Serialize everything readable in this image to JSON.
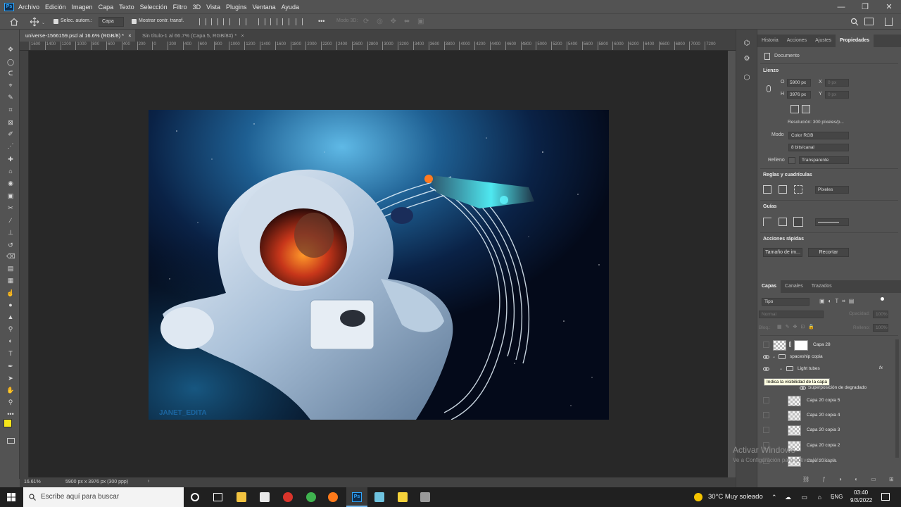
{
  "app": {
    "logo": "Ps",
    "menu": [
      "Archivo",
      "Edición",
      "Imagen",
      "Capa",
      "Texto",
      "Selección",
      "Filtro",
      "3D",
      "Vista",
      "Plugins",
      "Ventana",
      "Ayuda"
    ]
  },
  "window_controls": [
    "—",
    "❐",
    "✕"
  ],
  "options": {
    "auto_select_label": "Selec. autom.:",
    "auto_select_value": "Capa",
    "transform_label": "Mostrar contr. transf.",
    "mode3d_label": "Modo 3D:",
    "more": "•••"
  },
  "tabs": [
    {
      "label": "universe-1566159.psd al 16.6% (RGB/8) *",
      "close": "×"
    },
    {
      "label": "Sin título-1 al 66.7% (Capa 5, RGB/8#) *",
      "close": "×"
    }
  ],
  "ruler_ticks": [
    "1600",
    "1400",
    "1200",
    "1000",
    "800",
    "600",
    "400",
    "200",
    "0",
    "200",
    "400",
    "600",
    "800",
    "1000",
    "1200",
    "1400",
    "1600",
    "1800",
    "2000",
    "2200",
    "2400",
    "2600",
    "2800",
    "3000",
    "3200",
    "3400",
    "3600",
    "3800",
    "4000",
    "4200",
    "4400",
    "4600",
    "4800",
    "5000",
    "5200",
    "5400",
    "5600",
    "5800",
    "6000",
    "6200",
    "6400",
    "6600",
    "6800",
    "7000",
    "7200"
  ],
  "canvas": {
    "signature": "JANET_EDITA"
  },
  "status": {
    "zoom": "16.61%",
    "size": "5900 px x 3976 px (300 ppp)",
    "arrow": "›"
  },
  "properties": {
    "tabs": [
      "Historia",
      "Acciones",
      "Ajustes",
      "Propiedades"
    ],
    "doc_label": "Documento",
    "lienzo": "Lienzo",
    "w_label": "O",
    "w_value": "5900 px",
    "h_label": "H",
    "h_value": "3976 px",
    "x_label": "X",
    "x_value": "0 px",
    "y_label": "Y",
    "y_value": "0 px",
    "resolution": "Resolución: 300 píxeles/p...",
    "mode_label": "Modo",
    "mode_value": "Color RGB",
    "bits_value": "8 bits/canal",
    "fill_label": "Relleno",
    "fill_value": "Transparente",
    "rulers_header": "Reglas y cuadrículas",
    "units_value": "Píxeles",
    "guides_header": "Guías",
    "quick_header": "Acciones rápidas",
    "btn_image_size": "Tamaño de im...",
    "btn_crop": "Recortar"
  },
  "layers": {
    "tabs": [
      "Capas",
      "Canales",
      "Trazados"
    ],
    "filter_value": "Tipo",
    "blend_value": "Normal",
    "opacity_label": "Opacidad:",
    "opacity_value": "100%",
    "lock_label": "Bloq.:",
    "fill_label": "Relleno:",
    "fill_value": "100%",
    "rows": [
      {
        "name": "Capa 28"
      },
      {
        "name": "spaceship copia"
      },
      {
        "name": "Light tubes",
        "fx": "fx"
      },
      {
        "name": "Superposición de degradado"
      },
      {
        "name": "Capa 20 copia 5"
      },
      {
        "name": "Capa 20 copia 4"
      },
      {
        "name": "Capa 20 copia 3"
      },
      {
        "name": "Capa 20 copia 2"
      },
      {
        "name": "Capa 20 copia"
      }
    ],
    "tooltip": "Indica la visibilidad de la capa"
  },
  "watermark": {
    "line1": "Activar Windows",
    "line2": "Ve a Configuración para activar Windows."
  },
  "taskbar": {
    "search_placeholder": "Escribe aquí para buscar",
    "weather": "30°C  Muy soleado",
    "lang": "ENG",
    "time": "03:40",
    "date": "9/3/2022"
  },
  "colors": {
    "foreground": "#f5e51a",
    "background": "#2fc2d8",
    "accent": "#31a8ff"
  }
}
